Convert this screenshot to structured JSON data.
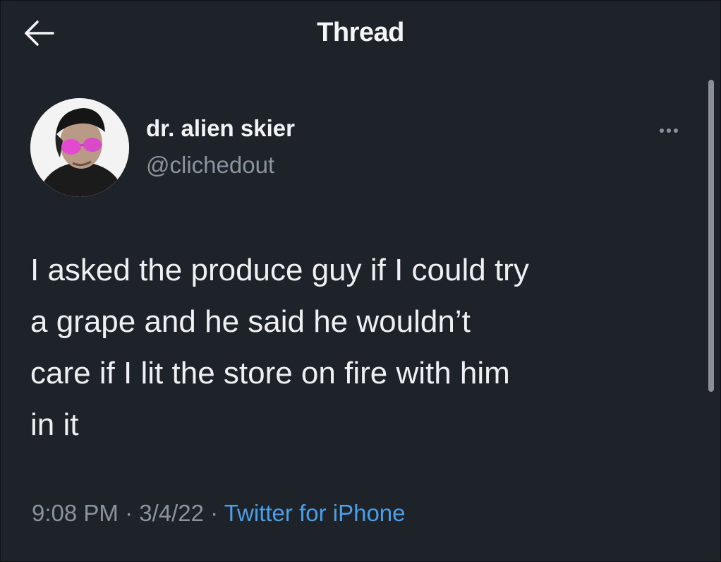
{
  "header": {
    "title": "Thread"
  },
  "author": {
    "display_name": "dr. alien skier",
    "handle": "@clichedout"
  },
  "tweet": {
    "text": "I asked the produce guy if I could try\na grape and he said he wouldn’t\ncare if I lit the store on fire with him\nin it",
    "time": "9:08 PM",
    "separator": " · ",
    "date": "3/4/22",
    "source": "Twitter for iPhone"
  },
  "icons": {
    "back": "arrow-left-icon",
    "more": "more-dots-icon"
  },
  "colors": {
    "background": "#1e2229",
    "text": "#eef0f2",
    "secondary_text": "#8b949e",
    "link": "#4a9fe8"
  }
}
